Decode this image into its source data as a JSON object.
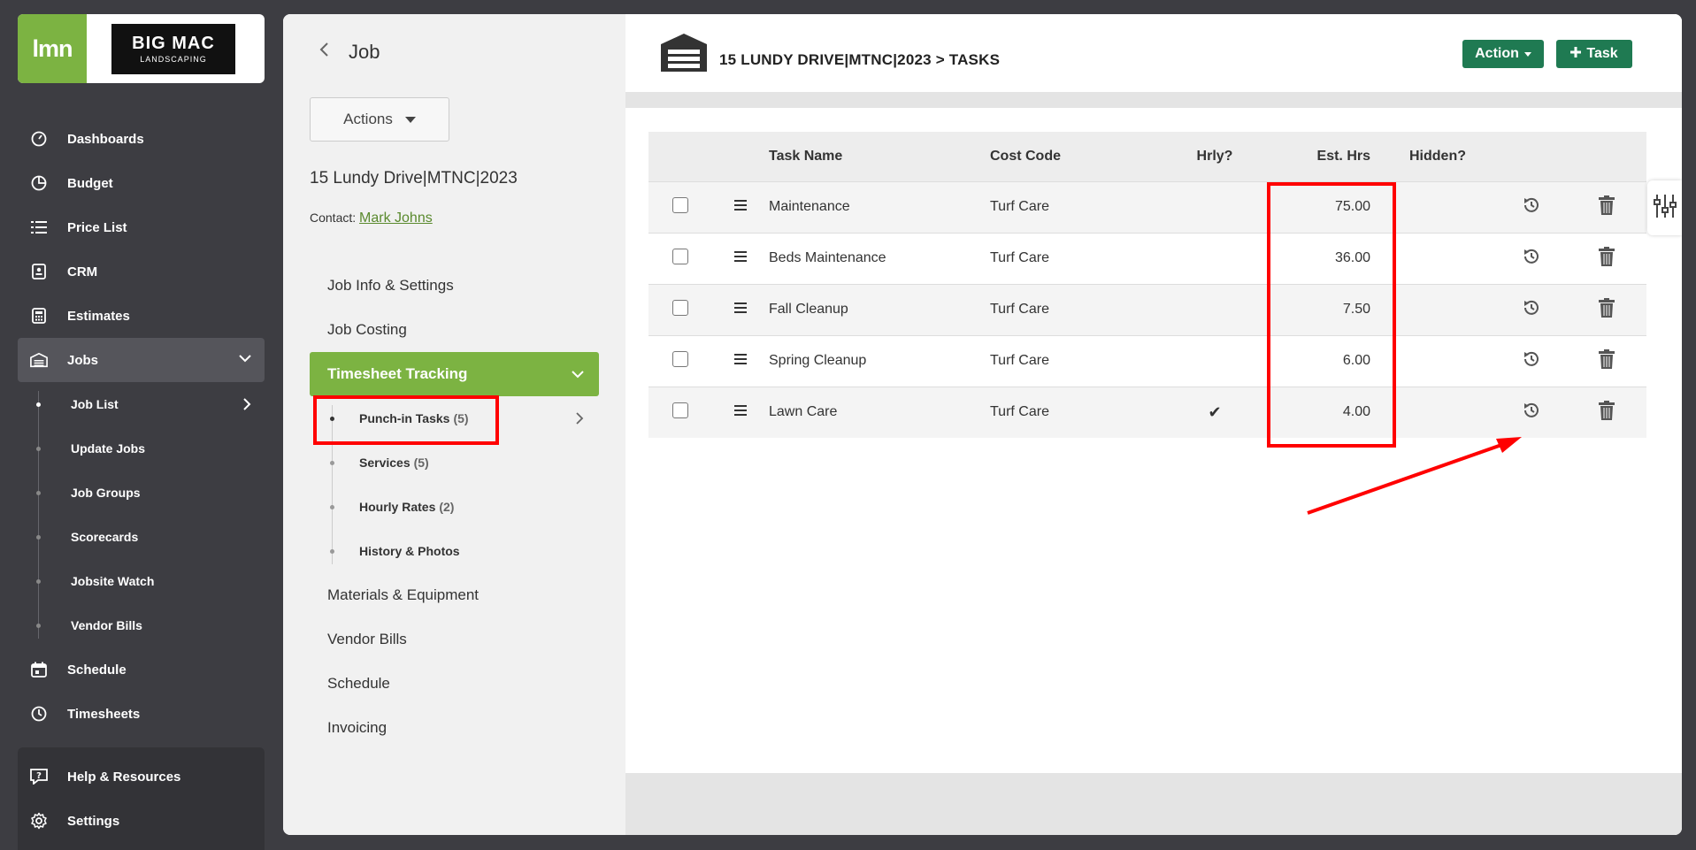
{
  "sidebar": {
    "logo": {
      "lmn": "lmn",
      "company_line1": "BIG MAC",
      "company_line2": "LANDSCAPING"
    },
    "items": [
      {
        "label": "Dashboards",
        "icon": "dashboard-icon"
      },
      {
        "label": "Budget",
        "icon": "pie-chart-icon"
      },
      {
        "label": "Price List",
        "icon": "list-icon"
      },
      {
        "label": "CRM",
        "icon": "contact-card-icon"
      },
      {
        "label": "Estimates",
        "icon": "calculator-icon"
      },
      {
        "label": "Jobs",
        "icon": "warehouse-icon"
      }
    ],
    "jobs_sub": [
      {
        "label": "Job List"
      },
      {
        "label": "Update Jobs"
      },
      {
        "label": "Job Groups"
      },
      {
        "label": "Scorecards"
      },
      {
        "label": "Jobsite Watch"
      },
      {
        "label": "Vendor Bills"
      }
    ],
    "lower_items": [
      {
        "label": "Schedule",
        "icon": "calendar-icon"
      },
      {
        "label": "Timesheets",
        "icon": "clock-icon"
      }
    ],
    "help": {
      "label": "Help & Resources"
    },
    "settings": {
      "label": "Settings"
    }
  },
  "job_panel": {
    "title": "Job",
    "actions_label": "Actions",
    "job_name": "15 Lundy Drive|MTNC|2023",
    "contact_label": "Contact:",
    "contact_name": "Mark Johns",
    "menu": [
      {
        "label": "Job Info & Settings"
      },
      {
        "label": "Job Costing"
      },
      {
        "label": "Timesheet Tracking"
      }
    ],
    "submenu": [
      {
        "label": "Punch-in Tasks",
        "count": "(5)"
      },
      {
        "label": "Services",
        "count": "(5)"
      },
      {
        "label": "Hourly Rates",
        "count": "(2)"
      },
      {
        "label": "History & Photos",
        "count": ""
      }
    ],
    "menu_lower": [
      {
        "label": "Materials & Equipment"
      },
      {
        "label": "Vendor Bills"
      },
      {
        "label": "Schedule"
      },
      {
        "label": "Invoicing"
      }
    ]
  },
  "tasks_panel": {
    "breadcrumb": "15 LUNDY DRIVE|MTNC|2023 > TASKS",
    "action_label": "Action",
    "task_label": "Task",
    "columns": [
      "Task Name",
      "Cost Code",
      "Hrly?",
      "Est. Hrs",
      "Hidden?"
    ],
    "rows": [
      {
        "name": "Maintenance",
        "cost_code": "Turf Care",
        "hourly": "",
        "est_hrs": "75.00"
      },
      {
        "name": "Beds Maintenance",
        "cost_code": "Turf Care",
        "hourly": "",
        "est_hrs": "36.00"
      },
      {
        "name": "Fall Cleanup",
        "cost_code": "Turf Care",
        "hourly": "",
        "est_hrs": "7.50"
      },
      {
        "name": "Spring Cleanup",
        "cost_code": "Turf Care",
        "hourly": "",
        "est_hrs": "6.00"
      },
      {
        "name": "Lawn Care",
        "cost_code": "Turf Care",
        "hourly": "✔",
        "est_hrs": "4.00"
      }
    ]
  },
  "colors": {
    "accent_green": "#7cb342",
    "button_green": "#1f7a52",
    "annotation_red": "#ff0000"
  }
}
